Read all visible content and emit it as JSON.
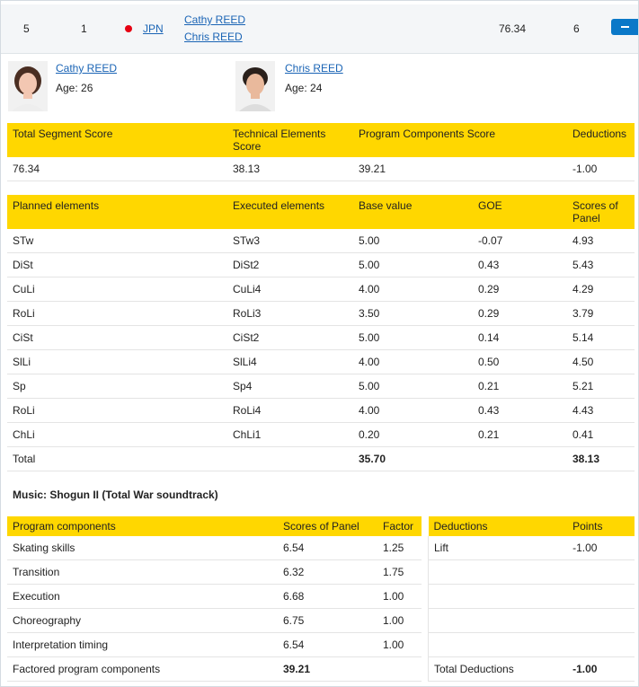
{
  "header": {
    "rank": "5",
    "start_no": "1",
    "country": "JPN",
    "skater1": "Cathy REED",
    "skater2": "Chris REED",
    "score": "76.34",
    "position": "6"
  },
  "skaters": [
    {
      "name": "Cathy REED",
      "age": "Age: 26"
    },
    {
      "name": "Chris REED",
      "age": "Age: 24"
    }
  ],
  "summary": {
    "headers": [
      "Total Segment Score",
      "Technical Elements Score",
      "Program Components Score",
      "Deductions"
    ],
    "values": [
      "76.34",
      "38.13",
      "39.21",
      "-1.00"
    ]
  },
  "elements": {
    "headers": [
      "Planned elements",
      "Executed elements",
      "Base value",
      "GOE",
      "Scores of Panel"
    ],
    "rows": [
      [
        "STw",
        "STw3",
        "5.00",
        "-0.07",
        "4.93"
      ],
      [
        "DiSt",
        "DiSt2",
        "5.00",
        "0.43",
        "5.43"
      ],
      [
        "CuLi",
        "CuLi4",
        "4.00",
        "0.29",
        "4.29"
      ],
      [
        "RoLi",
        "RoLi3",
        "3.50",
        "0.29",
        "3.79"
      ],
      [
        "CiSt",
        "CiSt2",
        "5.00",
        "0.14",
        "5.14"
      ],
      [
        "SlLi",
        "SlLi4",
        "4.00",
        "0.50",
        "4.50"
      ],
      [
        "Sp",
        "Sp4",
        "5.00",
        "0.21",
        "5.21"
      ],
      [
        "RoLi",
        "RoLi4",
        "4.00",
        "0.43",
        "4.43"
      ],
      [
        "ChLi",
        "ChLi1",
        "0.20",
        "0.21",
        "0.41"
      ]
    ],
    "total": [
      "Total",
      "",
      "35.70",
      "",
      "38.13"
    ]
  },
  "music": "Music: Shogun II (Total War soundtrack)",
  "components": {
    "headers": [
      "Program components",
      "Scores of Panel",
      "Factor"
    ],
    "rows": [
      [
        "Skating skills",
        "6.54",
        "1.25"
      ],
      [
        "Transition",
        "6.32",
        "1.75"
      ],
      [
        "Execution",
        "6.68",
        "1.00"
      ],
      [
        "Choreography",
        "6.75",
        "1.00"
      ],
      [
        "Interpretation timing",
        "6.54",
        "1.00"
      ]
    ],
    "total": [
      "Factored program components",
      "39.21",
      ""
    ]
  },
  "deductions": {
    "headers": [
      "Deductions",
      "Points"
    ],
    "rows": [
      [
        "Lift",
        "-1.00"
      ],
      [
        "",
        ""
      ],
      [
        "",
        ""
      ],
      [
        "",
        ""
      ],
      [
        "",
        ""
      ]
    ],
    "total": [
      "Total Deductions",
      "-1.00"
    ]
  },
  "colors": {
    "header_yellow": "#ffd700",
    "link_blue": "#1a64b5",
    "button_blue": "#0a78c8",
    "flag_red": "#e60012"
  },
  "icons": {
    "collapse": "minus-icon",
    "flag": "japan-flag-icon"
  }
}
